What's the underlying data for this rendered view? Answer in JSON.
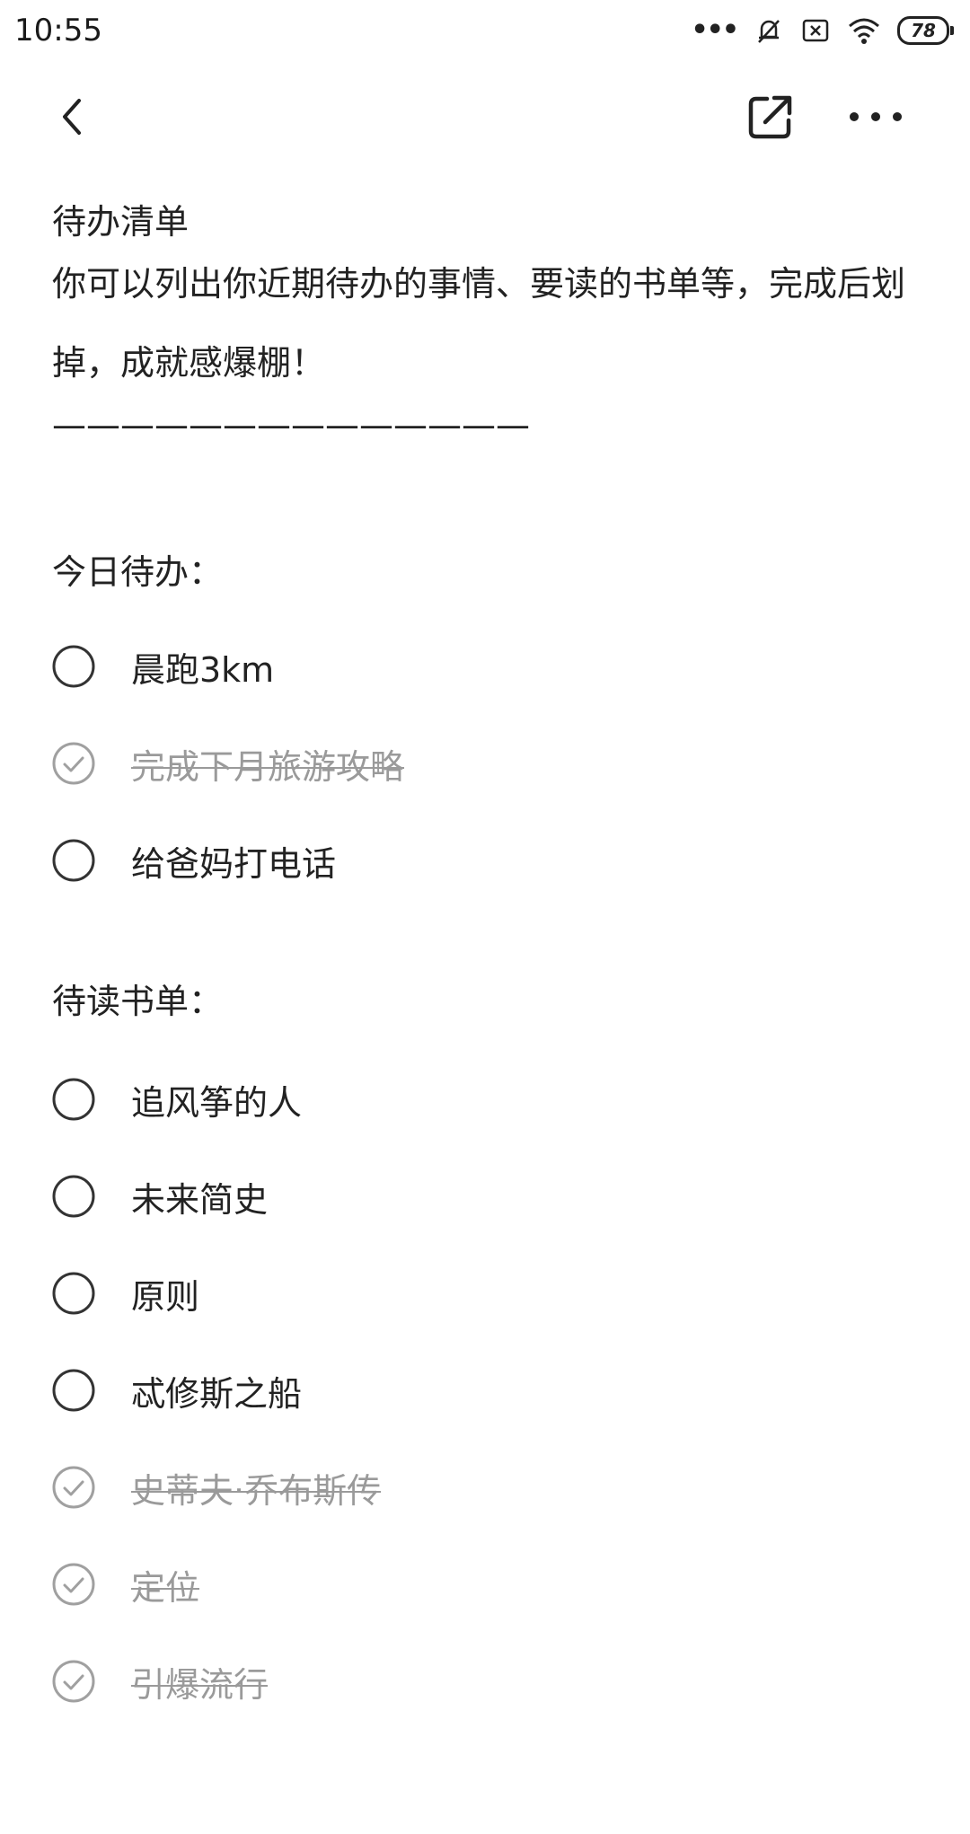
{
  "status_bar": {
    "time": "10:55",
    "battery": "78"
  },
  "note": {
    "title": "待办清单",
    "description": "你可以列出你近期待办的事情、要读的书单等，完成后划掉，成就感爆棚！",
    "divider": "——————————————"
  },
  "sections": [
    {
      "heading": "今日待办：",
      "items": [
        {
          "text": "晨跑3km",
          "done": false
        },
        {
          "text": "完成下月旅游攻略",
          "done": true
        },
        {
          "text": "给爸妈打电话",
          "done": false
        }
      ]
    },
    {
      "heading": "待读书单：",
      "items": [
        {
          "text": "追风筝的人",
          "done": false
        },
        {
          "text": "未来简史",
          "done": false
        },
        {
          "text": "原则",
          "done": false
        },
        {
          "text": "忒修斯之船",
          "done": false
        },
        {
          "text": "史蒂夫·乔布斯传",
          "done": true
        },
        {
          "text": "定位",
          "done": true
        },
        {
          "text": "引爆流行",
          "done": true
        }
      ]
    }
  ],
  "colors": {
    "text": "#222222",
    "done_text": "#9a9a9a",
    "circle": "#333333",
    "done_circle": "#a0a0a0"
  },
  "icons": [
    "back-arrow-icon",
    "share-icon",
    "more-icon",
    "circle-unchecked-icon",
    "circle-checked-icon"
  ]
}
